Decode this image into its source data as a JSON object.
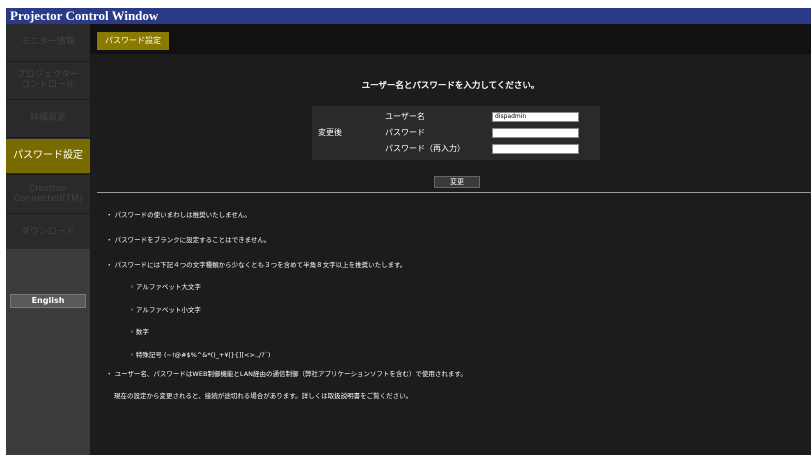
{
  "window": {
    "title": "Projector Control Window"
  },
  "sidebar": {
    "items": [
      {
        "label": "モニター情報"
      },
      {
        "label": "プロジェクター\nコントロール"
      },
      {
        "label": "詳細設定"
      },
      {
        "label": "パスワード設定"
      },
      {
        "label": "Crestron\nConnected(TM)"
      },
      {
        "label": "ダウンロード"
      }
    ],
    "active_index": 3,
    "language_button": "English"
  },
  "tab": {
    "label": "パスワード設定"
  },
  "form": {
    "heading": "ユーザー名とパスワードを入力してください。",
    "section_label": "変更後",
    "username_label": "ユーザー名",
    "username_value": "dispadmin",
    "password_label": "パスワード",
    "password_confirm_label": "パスワード（再入力）",
    "submit_label": "変更"
  },
  "notes": {
    "n1": "・ パスワードの使いまわしは推奨いたしません。",
    "n2": "・ パスワードをブランクに設定することはできません。",
    "n3": "・ パスワードには下記４つの文字種類から少なくとも３つを含めて半角８文字以上を推奨いたします。",
    "s1": "◦ アルファベット大文字",
    "s2": "◦ アルファベット小文字",
    "s3": "◦ 数字",
    "s4": "◦ 特殊記号 (~!@#$%^&*()_+¥|}{][<>.,/?`)",
    "n4": "・ ユーザー名、パスワードはWEB制御機能とLAN経由の通信制御（弊社アプリケーションソフトを含む）で使用されます。",
    "n5": "現在の設定から変更されると、接続が途切れる場合があります。詳しくは取扱説明書をご覧ください。"
  },
  "colors": {
    "title_bar": "#2a3a86",
    "active_accent": "#7a6b00",
    "background": "#1c1c1c"
  }
}
